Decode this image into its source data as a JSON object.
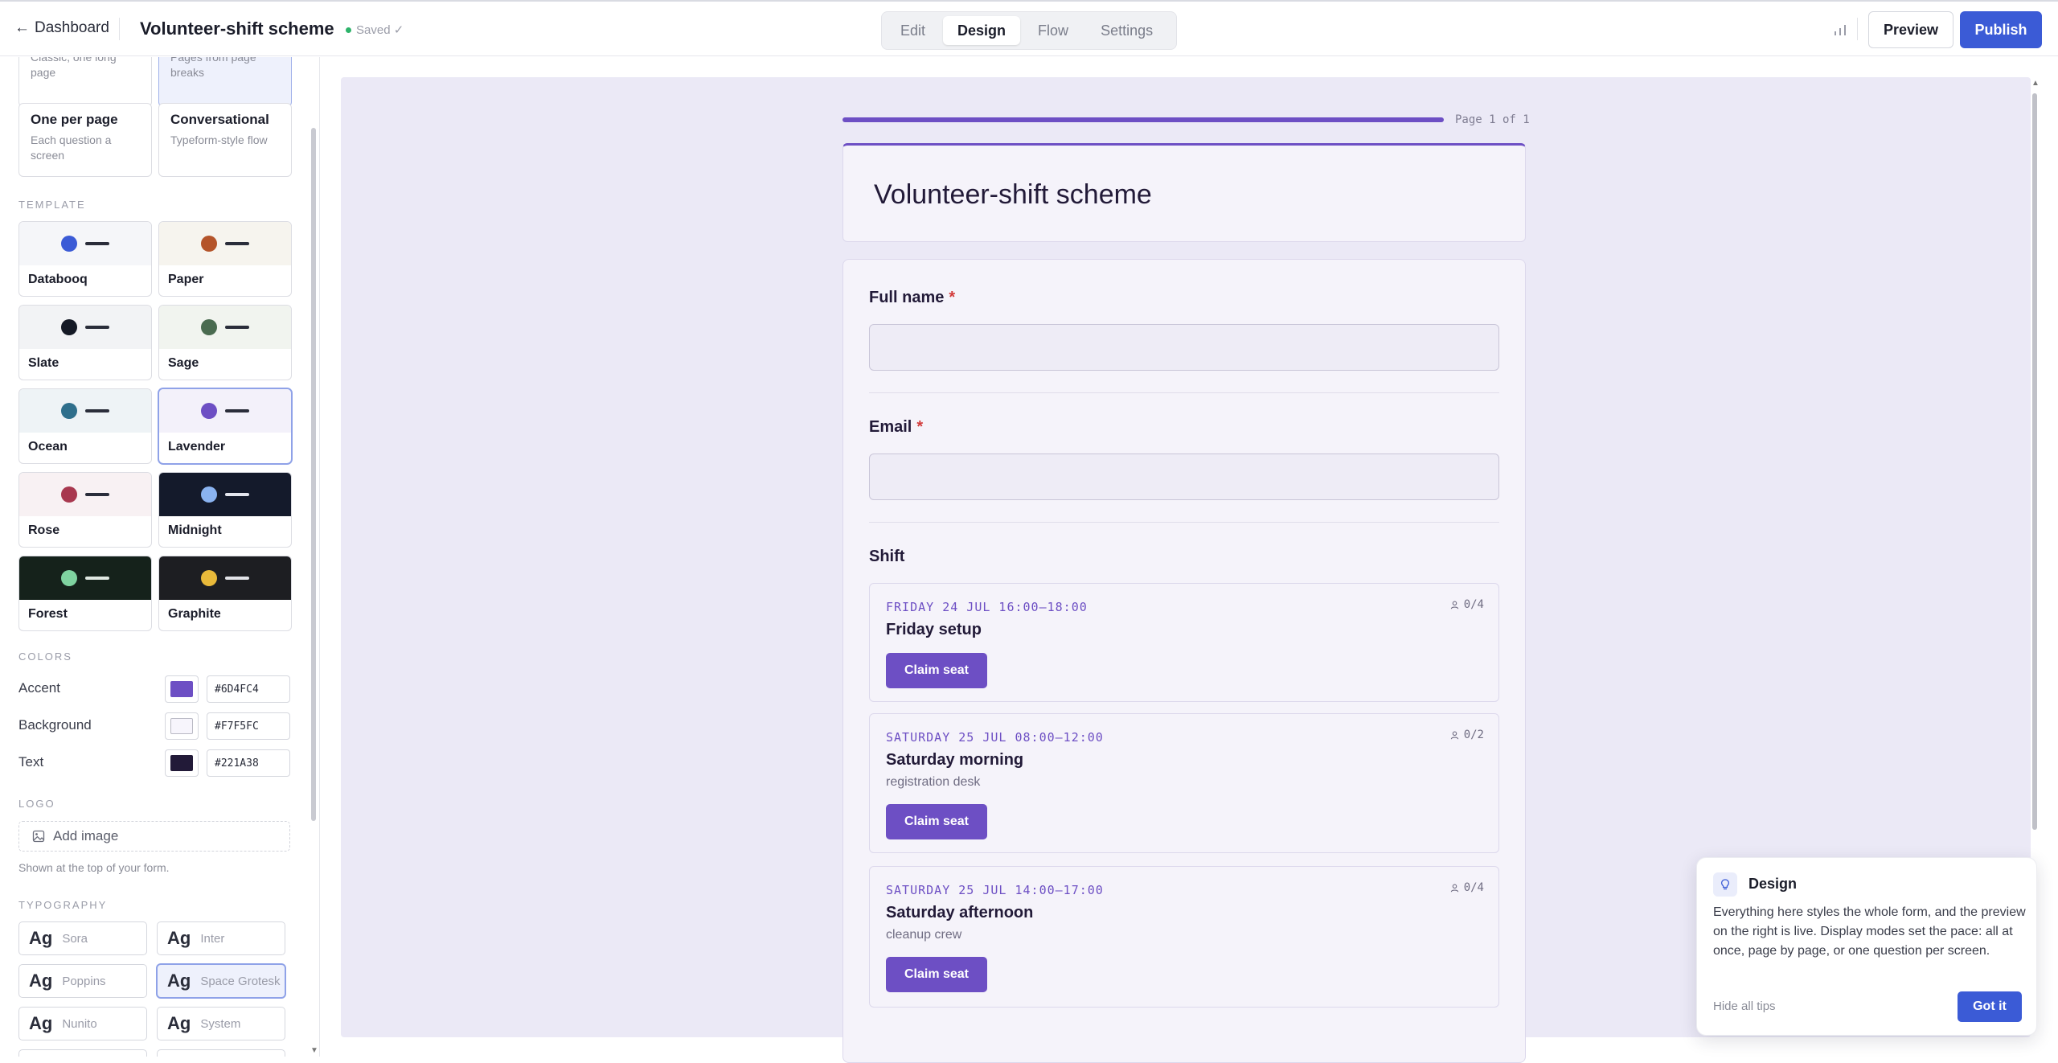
{
  "topbar": {
    "back_label": "Dashboard",
    "form_title": "Volunteer-shift scheme",
    "saved_label": "Saved ✓",
    "tabs": [
      {
        "label": "Edit"
      },
      {
        "label": "Design"
      },
      {
        "label": "Flow"
      },
      {
        "label": "Settings"
      }
    ],
    "active_tab": "Design",
    "preview_label": "Preview",
    "publish_label": "Publish"
  },
  "sidebar": {
    "modes": [
      {
        "title": "",
        "desc": "Classic, one long page"
      },
      {
        "title": "",
        "desc": "Pages from page breaks",
        "selected": true
      },
      {
        "title": "One per page",
        "desc": "Each question a screen"
      },
      {
        "title": "Conversational",
        "desc": "Typeform-style flow"
      }
    ],
    "template_heading": "TEMPLATE",
    "templates": [
      {
        "name": "Databooq",
        "bg": "#f5f6f9",
        "dot": "#3b5bd6",
        "bar": "#2a2d3a"
      },
      {
        "name": "Paper",
        "bg": "#f6f4ee",
        "dot": "#b4542a",
        "bar": "#2a2d3a"
      },
      {
        "name": "Slate",
        "bg": "#f2f3f5",
        "dot": "#151a26",
        "bar": "#2a2d3a"
      },
      {
        "name": "Sage",
        "bg": "#f1f4ef",
        "dot": "#4a6b50",
        "bar": "#2a2d3a"
      },
      {
        "name": "Ocean",
        "bg": "#eef3f6",
        "dot": "#2f6f8c",
        "bar": "#2a2d3a"
      },
      {
        "name": "Lavender",
        "bg": "#f3f1fa",
        "dot": "#6d4fc4",
        "bar": "#2a2d3a",
        "selected": true
      },
      {
        "name": "Rose",
        "bg": "#f8f1f3",
        "dot": "#a8384f",
        "bar": "#2a2d3a"
      },
      {
        "name": "Midnight",
        "bg": "#141a2b",
        "dot": "#8ab3f0",
        "bar": "#e4e6ee"
      },
      {
        "name": "Forest",
        "bg": "#15221b",
        "dot": "#7fd3a0",
        "bar": "#dfe8e2"
      },
      {
        "name": "Graphite",
        "bg": "#1d1e22",
        "dot": "#e8b93a",
        "bar": "#e2e3e8"
      }
    ],
    "colors_heading": "COLORS",
    "colors": [
      {
        "label": "Accent",
        "value": "#6D4FC4"
      },
      {
        "label": "Background",
        "value": "#F7F5FC"
      },
      {
        "label": "Text",
        "value": "#221A38"
      }
    ],
    "logo_heading": "LOGO",
    "add_image_label": "Add image",
    "logo_note": "Shown at the top of your form.",
    "typography_heading": "TYPOGRAPHY",
    "fonts": [
      {
        "sample": "Ag",
        "name": "Sora"
      },
      {
        "sample": "Ag",
        "name": "Inter"
      },
      {
        "sample": "Ag",
        "name": "Poppins"
      },
      {
        "sample": "Ag",
        "name": "Space Grotesk",
        "selected": true
      },
      {
        "sample": "Ag",
        "name": "Nunito"
      },
      {
        "sample": "Ag",
        "name": "System"
      }
    ]
  },
  "preview": {
    "page_label": "Page 1 of 1",
    "progress": 1.0,
    "form_title": "Volunteer-shift scheme",
    "questions": [
      {
        "label": "Full name",
        "required": "*"
      },
      {
        "label": "Email",
        "required": "*"
      }
    ],
    "shift_heading": "Shift",
    "shifts": [
      {
        "datetime": "FRIDAY 24 JUL 16:00–18:00",
        "name": "Friday setup",
        "note": "",
        "capacity": "0/4",
        "button": "Claim seat"
      },
      {
        "datetime": "SATURDAY 25 JUL 08:00–12:00",
        "name": "Saturday morning",
        "note": "registration desk",
        "capacity": "0/2",
        "button": "Claim seat"
      },
      {
        "datetime": "SATURDAY 25 JUL 14:00–17:00",
        "name": "Saturday afternoon",
        "note": "cleanup crew",
        "capacity": "0/4",
        "button": "Claim seat"
      }
    ]
  },
  "tip": {
    "title": "Design",
    "text": "Everything here styles the whole form, and the preview on the right is live. Display modes set the pace: all at once, page by page, or one question per screen.",
    "hide_label": "Hide all tips",
    "got_label": "Got it"
  }
}
